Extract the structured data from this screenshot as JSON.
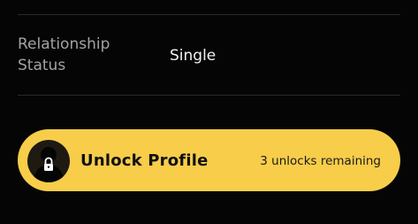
{
  "profile_details": {
    "relationship": {
      "label": "Relationship\nStatus",
      "value": "Single"
    }
  },
  "unlock": {
    "title": "Unlock Profile",
    "remaining": "3 unlocks remaining",
    "icon": "locked-avatar-icon",
    "accent_color": "#f7cd4a"
  }
}
